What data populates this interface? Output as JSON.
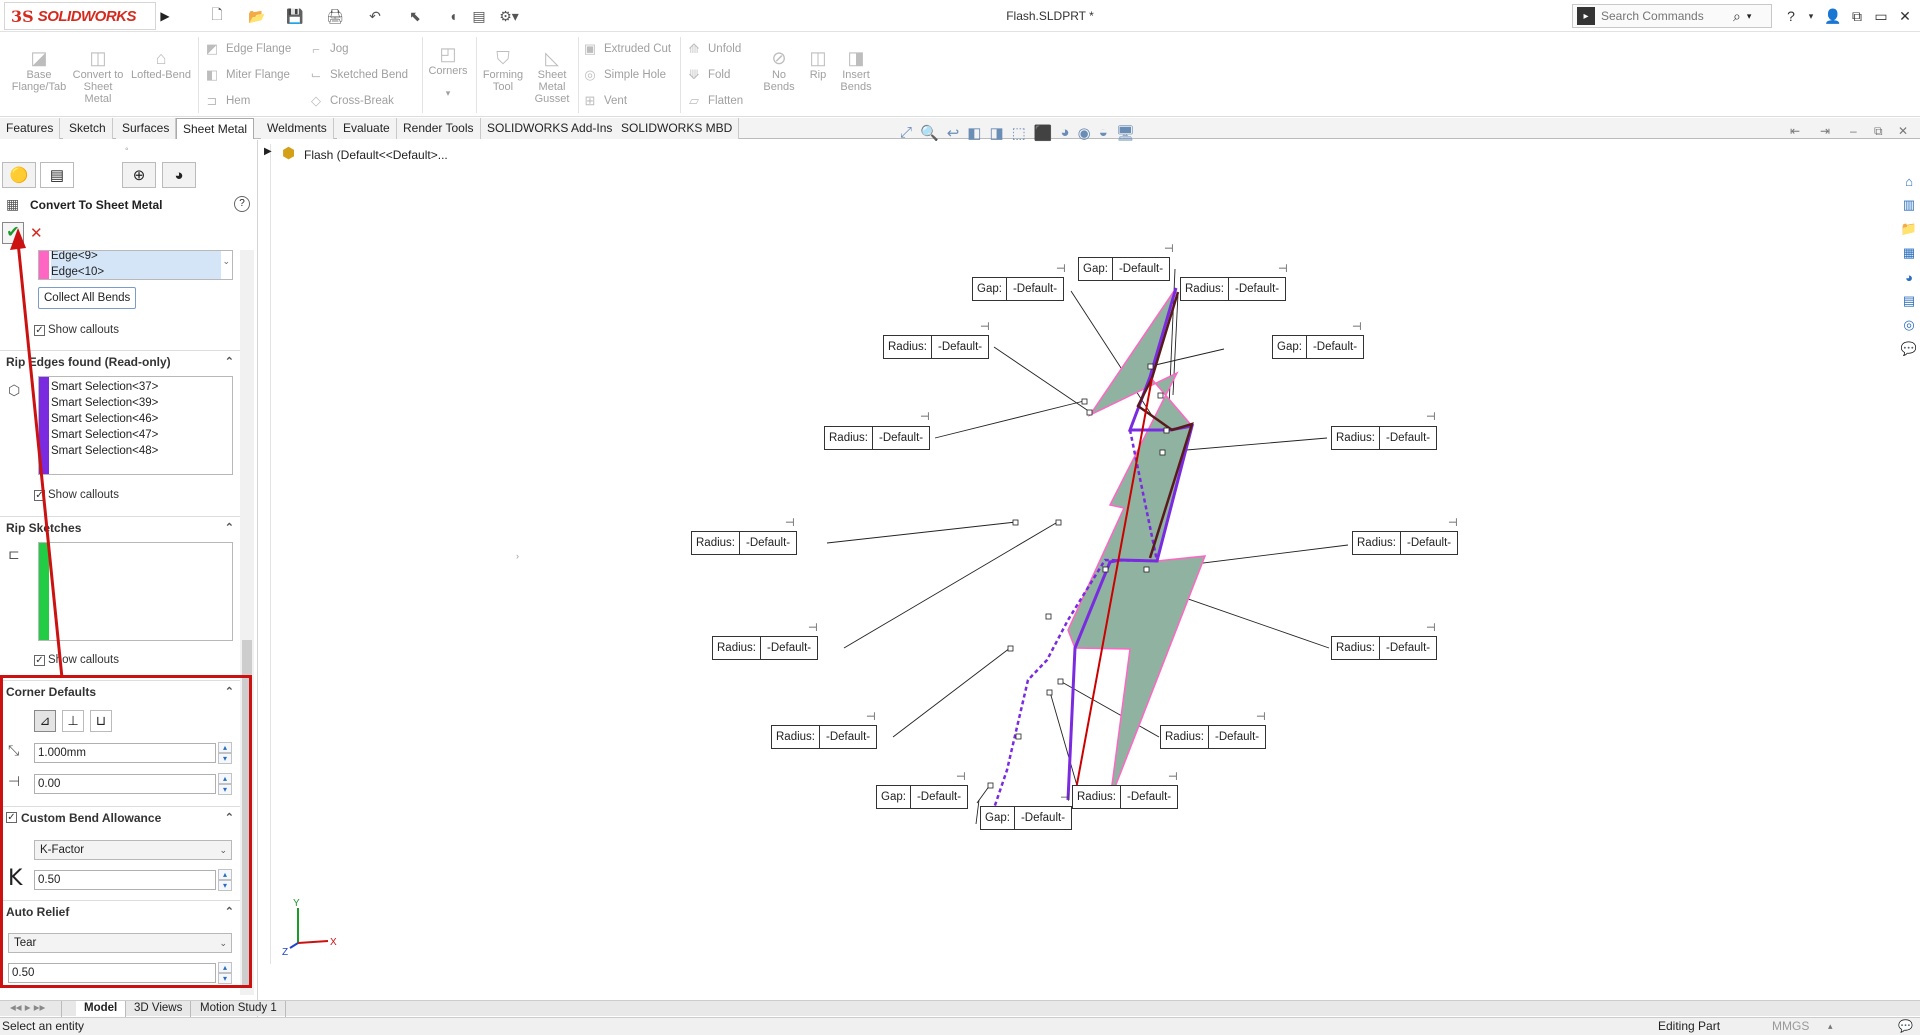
{
  "app": {
    "logo_ds": "3S",
    "logo_name": "SOLIDWORKS",
    "document_title": "Flash.SLDPRT *"
  },
  "search": {
    "placeholder": "Search Commands"
  },
  "toolbar": {
    "base_flange": "Base Flange/Tab",
    "convert": "Convert to Sheet Metal",
    "lofted_bend": "Lofted-Bend",
    "edge_flange": "Edge Flange",
    "miter_flange": "Miter Flange",
    "hem": "Hem",
    "jog": "Jog",
    "sketched_bend": "Sketched Bend",
    "cross_break": "Cross-Break",
    "corners": "Corners",
    "forming_tool": "Forming Tool",
    "gusset": "Sheet Metal Gusset",
    "extruded_cut": "Extruded Cut",
    "simple_hole": "Simple Hole",
    "vent": "Vent",
    "unfold": "Unfold",
    "fold": "Fold",
    "flatten": "Flatten",
    "no_bends": "No Bends",
    "rip": "Rip",
    "insert_bends": "Insert Bends"
  },
  "tabs": [
    "Features",
    "Sketch",
    "Surfaces",
    "Sheet Metal",
    "Weldments",
    "Evaluate",
    "Render Tools",
    "SOLIDWORKS Add-Ins",
    "SOLIDWORKS MBD"
  ],
  "tree": {
    "root": "Flash  (Default<<Default>..."
  },
  "panel": {
    "title": "Convert To Sheet Metal",
    "edges": [
      "Edge<9>",
      "Edge<10>"
    ],
    "collect_all_bends": "Collect All Bends",
    "show_callouts": "Show callouts",
    "rip_edges_header": "Rip Edges found (Read-only)",
    "rip_edges": [
      "Smart Selection<37>",
      "Smart Selection<39>",
      "Smart Selection<46>",
      "Smart Selection<47>",
      "Smart Selection<48>"
    ],
    "rip_sketches_header": "Rip Sketches",
    "corner_defaults_header": "Corner Defaults",
    "gap_value": "1.000mm",
    "ratio_value": "0.00",
    "custom_bend_header": "Custom Bend Allowance",
    "bend_type": "K-Factor",
    "k_label": "K",
    "k_value": "0.50",
    "auto_relief_header": "Auto Relief",
    "relief_type": "Tear",
    "relief_value": "0.50"
  },
  "callouts": {
    "radius_label": "Radius:",
    "gap_label": "Gap:",
    "default_value": "-Default-"
  },
  "bottom_tabs": [
    "Model",
    "3D Views",
    "Motion Study 1"
  ],
  "status": {
    "message": "Select an entity",
    "mode": "Editing Part",
    "units": "MMGS"
  },
  "colors": {
    "brand": "#d52b1e",
    "highlight": "#cc0000",
    "part_fill": "#8fb3a0",
    "edge_purple": "#7a2be0",
    "edge_pink": "#ff66c4",
    "rip_green": "#22cc44"
  }
}
